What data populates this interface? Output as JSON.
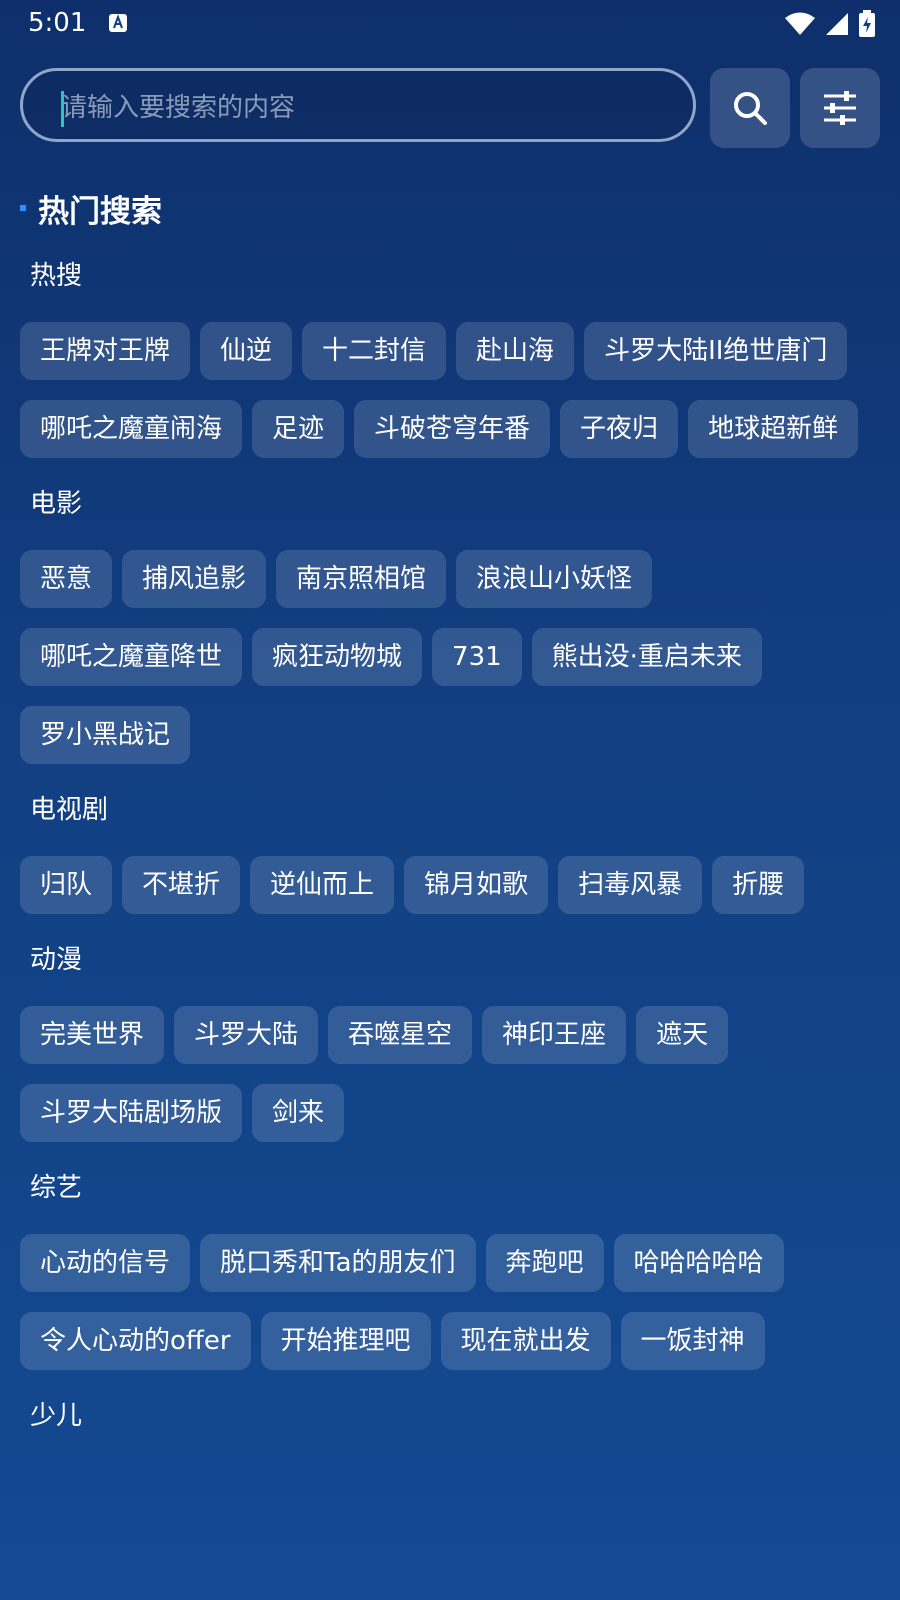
{
  "status_bar": {
    "time": "5:01"
  },
  "search": {
    "placeholder": "请输入要搜索的内容"
  },
  "section": {
    "title": "热门搜索"
  },
  "categories": [
    {
      "label": "热搜",
      "tags": [
        "王牌对王牌",
        "仙逆",
        "十二封信",
        "赴山海",
        "斗罗大陆II绝世唐门",
        "哪吒之魔童闹海",
        "足迹",
        "斗破苍穹年番",
        "子夜归",
        "地球超新鲜"
      ]
    },
    {
      "label": "电影",
      "tags": [
        "恶意",
        "捕风追影",
        "南京照相馆",
        "浪浪山小妖怪",
        "哪吒之魔童降世",
        "疯狂动物城",
        "731",
        "熊出没·重启未来",
        "罗小黑战记"
      ]
    },
    {
      "label": "电视剧",
      "tags": [
        "归队",
        "不堪折",
        "逆仙而上",
        "锦月如歌",
        "扫毒风暴",
        "折腰"
      ]
    },
    {
      "label": "动漫",
      "tags": [
        "完美世界",
        "斗罗大陆",
        "吞噬星空",
        "神印王座",
        "遮天",
        "斗罗大陆剧场版",
        "剑来"
      ]
    },
    {
      "label": "综艺",
      "tags": [
        "心动的信号",
        "脱口秀和Ta的朋友们",
        "奔跑吧",
        "哈哈哈哈哈",
        "令人心动的offer",
        "开始推理吧",
        "现在就出发",
        "一饭封神"
      ]
    },
    {
      "label": "少儿",
      "tags": []
    }
  ],
  "icons": {
    "accessibility": "a-icon",
    "wifi": "wifi-icon",
    "signal": "signal-icon",
    "battery": "battery-icon",
    "search": "search-icon",
    "filter": "sliders-icon"
  },
  "colors": {
    "accent": "#2e8fff",
    "caret": "#2ec4b6"
  }
}
